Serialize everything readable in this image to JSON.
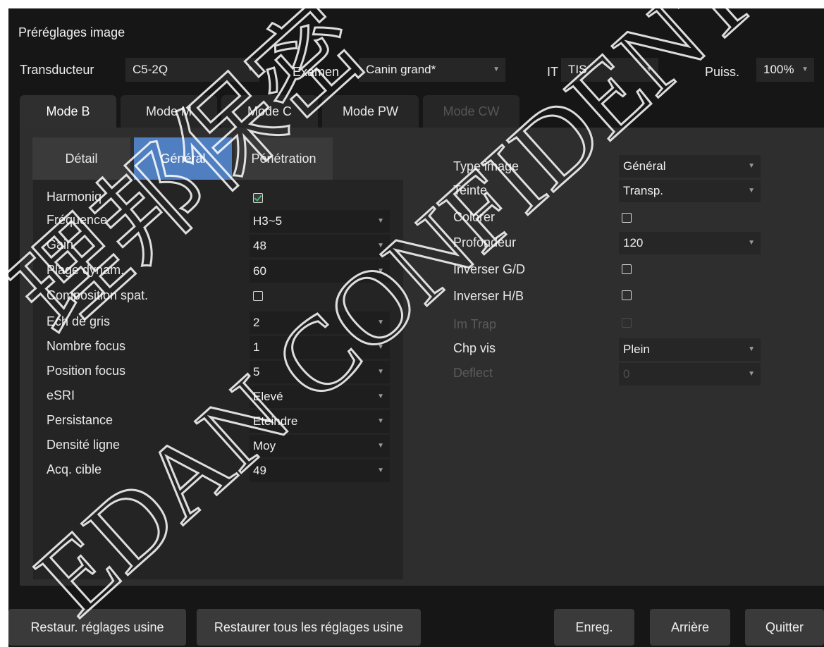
{
  "window": {
    "title": "Préréglages image"
  },
  "top_bar": {
    "transducer_label": "Transducteur",
    "transducer_value": "C5-2Q",
    "exam_label": "Examen",
    "exam_value": "Canin grand*",
    "it_label": "IT",
    "it_value": "TIS",
    "power_label": "Puiss.",
    "power_value": "100%"
  },
  "mode_tabs": [
    {
      "label": "Mode B",
      "state": "active"
    },
    {
      "label": "Mode M",
      "state": "normal"
    },
    {
      "label": "Mode C",
      "state": "normal"
    },
    {
      "label": "Mode PW",
      "state": "normal"
    },
    {
      "label": "Mode CW",
      "state": "disabled"
    }
  ],
  "sub_tabs": [
    {
      "label": "Détail",
      "state": "normal"
    },
    {
      "label": "Général",
      "state": "active"
    },
    {
      "label": "Pénétration",
      "state": "normal"
    }
  ],
  "left_params": [
    {
      "label": "Harmoniq",
      "type": "checkbox",
      "checked": true
    },
    {
      "label": "Fréquence",
      "type": "select",
      "value": "H3~5"
    },
    {
      "label": "Gain",
      "type": "select",
      "value": "48"
    },
    {
      "label": "Plage dynam.",
      "type": "select",
      "value": "60"
    },
    {
      "label": "Composition spat.",
      "type": "checkbox",
      "checked": false
    },
    {
      "label": "Ech de gris",
      "type": "select",
      "value": "2"
    },
    {
      "label": "Nombre focus",
      "type": "select",
      "value": "1"
    },
    {
      "label": "Position focus",
      "type": "select",
      "value": "5"
    },
    {
      "label": "eSRI",
      "type": "select",
      "value": "Elevé"
    },
    {
      "label": "Persistance",
      "type": "select",
      "value": "Eteindre"
    },
    {
      "label": "Densité ligne",
      "type": "select",
      "value": "Moy"
    },
    {
      "label": "Acq. cible",
      "type": "select",
      "value": "49"
    }
  ],
  "right_params": [
    {
      "label": "Type image",
      "type": "select",
      "value": "Général",
      "disabled": false
    },
    {
      "label": "Teinte",
      "type": "select",
      "value": "Transp.",
      "disabled": false
    },
    {
      "label": "Colorer",
      "type": "checkbox",
      "checked": false,
      "disabled": false
    },
    {
      "label": "Profondeur",
      "type": "select",
      "value": "120",
      "disabled": false
    },
    {
      "label": "Inverser G/D",
      "type": "checkbox",
      "checked": false,
      "disabled": false
    },
    {
      "label": "Inverser H/B",
      "type": "checkbox",
      "checked": false,
      "disabled": false
    },
    {
      "label": "Im Trap",
      "type": "checkbox",
      "checked": false,
      "disabled": true
    },
    {
      "label": "Chp vis",
      "type": "select",
      "value": "Plein",
      "disabled": false
    },
    {
      "label": "Deflect",
      "type": "select",
      "value": "0",
      "disabled": true
    }
  ],
  "buttons": {
    "restore_factory": "Restaur. réglages usine",
    "restore_all_factory": "Restaurer tous les réglages usine",
    "save": "Enreg.",
    "back": "Arrière",
    "quit": "Quitter"
  },
  "watermark": {
    "text": "EDAN CONFIDENTIAL",
    "chinese_text": "理邦保密"
  },
  "colors": {
    "background": "#161616",
    "panel": "#2e2e2e",
    "accent": "#4f7fc0",
    "check": "#3cc06a"
  }
}
